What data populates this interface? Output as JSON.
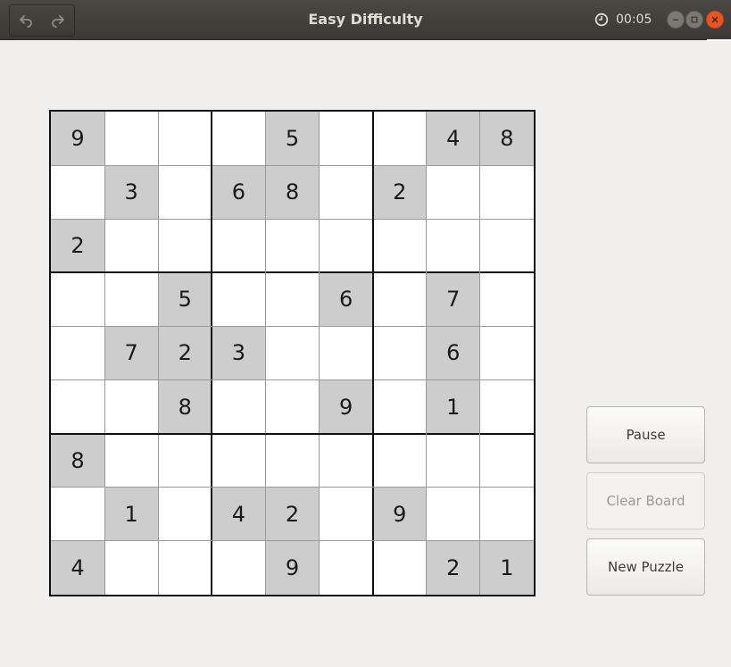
{
  "window": {
    "title": "Easy Difficulty",
    "timer": "00:05"
  },
  "toolbar": {
    "undo_icon": "undo-icon",
    "redo_icon": "redo-icon"
  },
  "board": {
    "size": 9,
    "rows": [
      [
        "9",
        "",
        "",
        "",
        "5",
        "",
        "",
        "4",
        "8"
      ],
      [
        "",
        "3",
        "",
        "6",
        "8",
        "",
        "2",
        "",
        ""
      ],
      [
        "2",
        "",
        "",
        "",
        "",
        "",
        "",
        "",
        ""
      ],
      [
        "",
        "",
        "5",
        "",
        "",
        "6",
        "",
        "7",
        ""
      ],
      [
        "",
        "7",
        "2",
        "3",
        "",
        "",
        "",
        "6",
        ""
      ],
      [
        "",
        "",
        "8",
        "",
        "",
        "9",
        "",
        "1",
        ""
      ],
      [
        "8",
        "",
        "",
        "",
        "",
        "",
        "",
        "",
        ""
      ],
      [
        "",
        "1",
        "",
        "4",
        "2",
        "",
        "9",
        "",
        ""
      ],
      [
        "4",
        "",
        "",
        "",
        "9",
        "",
        "",
        "2",
        "1"
      ]
    ]
  },
  "buttons": {
    "pause": "Pause",
    "clear": "Clear Board",
    "new_puzzle": "New Puzzle"
  },
  "colors": {
    "given_cell": "#cdcdcd",
    "close_button": "#e95420",
    "titlebar": "#3f3e3a"
  }
}
